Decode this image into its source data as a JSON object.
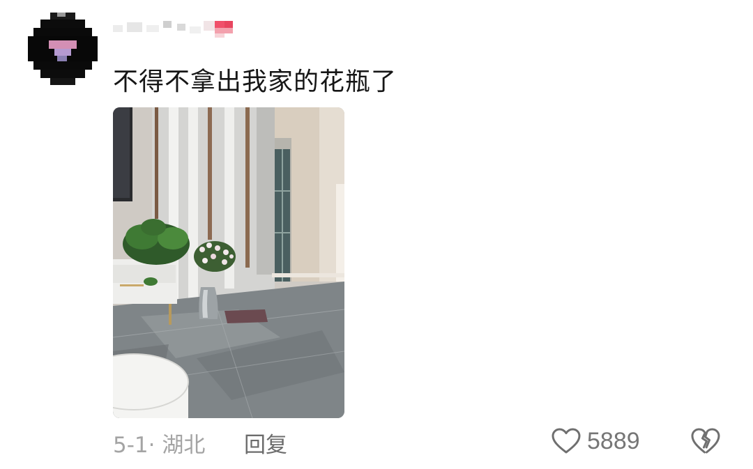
{
  "comment": {
    "text": "不得不拿出我家的花瓶了",
    "date": "5-1",
    "separator": "·",
    "location": "湖北",
    "reply_label": "回复",
    "like_count": "5889"
  },
  "icons": {
    "like": "heart-outline-icon",
    "dislike": "broken-heart-icon"
  },
  "colors": {
    "text": "#161616",
    "meta": "#a4a4a4",
    "reply": "#6c6c6c",
    "count": "#767676"
  }
}
